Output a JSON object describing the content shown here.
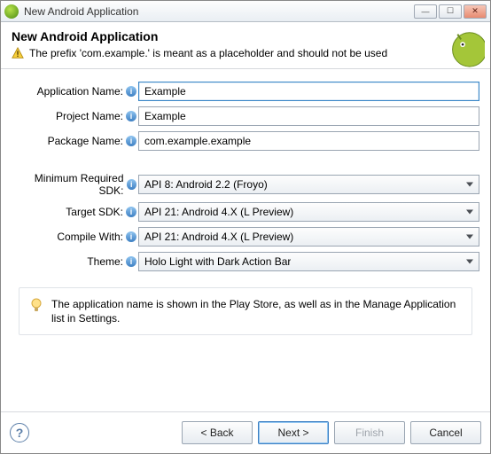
{
  "window": {
    "title": "New Android Application"
  },
  "header": {
    "title": "New Android Application",
    "warning": "The prefix 'com.example.' is meant as a placeholder and should not be used"
  },
  "fields": {
    "appName": {
      "label": "Application Name:",
      "value": "Example"
    },
    "projectName": {
      "label": "Project Name:",
      "value": "Example"
    },
    "packageName": {
      "label": "Package Name:",
      "value": "com.example.example"
    },
    "minSdk": {
      "label": "Minimum Required SDK:",
      "value": "API 8: Android 2.2 (Froyo)"
    },
    "targetSdk": {
      "label": "Target SDK:",
      "value": "API 21: Android 4.X (L Preview)"
    },
    "compileWith": {
      "label": "Compile With:",
      "value": "API 21: Android 4.X (L Preview)"
    },
    "theme": {
      "label": "Theme:",
      "value": "Holo Light with Dark Action Bar"
    }
  },
  "tip": "The application name is shown in the Play Store, as well as in the Manage Application list in Settings.",
  "buttons": {
    "back": "< Back",
    "next": "Next >",
    "finish": "Finish",
    "cancel": "Cancel"
  }
}
